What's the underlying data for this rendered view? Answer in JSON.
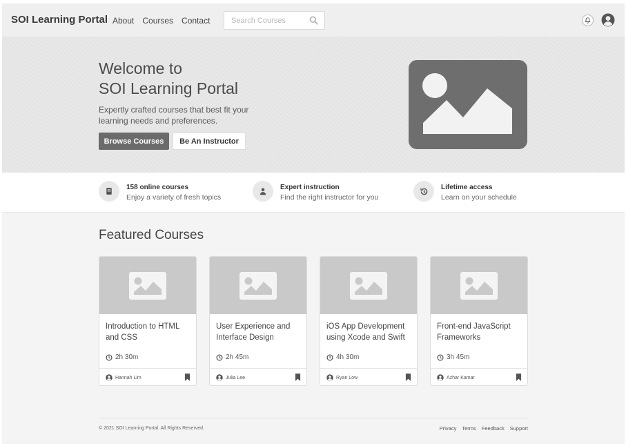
{
  "nav": {
    "brand": "SOI Learning Portal",
    "links": [
      "About",
      "Courses",
      "Contact"
    ],
    "search_placeholder": "Search Courses"
  },
  "hero": {
    "title_line1": "Welcome to",
    "title_line2": "SOI Learning Portal",
    "subtitle": "Expertly crafted courses that best fit your learning needs and preferences.",
    "primary_button": "Browse Courses",
    "secondary_button": "Be An Instructor"
  },
  "features": [
    {
      "title": "158 online courses",
      "desc": "Enjoy a variety of fresh topics",
      "icon": "book-icon"
    },
    {
      "title": "Expert instruction",
      "desc": "Find the right instructor for you",
      "icon": "instructor-icon"
    },
    {
      "title": "Lifetime access",
      "desc": "Learn on your schedule",
      "icon": "history-icon"
    }
  ],
  "featured": {
    "heading": "Featured Courses",
    "courses": [
      {
        "title": "Introduction to HTML and CSS",
        "duration": "2h 30m",
        "instructor": "Hannah Lim"
      },
      {
        "title": "User Experience and Interface Design",
        "duration": "2h 45m",
        "instructor": "Julia Lee"
      },
      {
        "title": "iOS App Development using Xcode and Swift",
        "duration": "4h 30m",
        "instructor": "Ryan Low"
      },
      {
        "title": "Front-end JavaScript Frameworks",
        "duration": "3h 45m",
        "instructor": "Azhar Kamar"
      }
    ]
  },
  "footer": {
    "copyright": "© 2021 SOI Learning Portal. All Rights Reserved.",
    "links": [
      "Privacy",
      "Terms",
      "Feedback",
      "Support"
    ]
  },
  "colors": {
    "primary_button": "#6b6b6b",
    "hero_image": "#6e6e6e",
    "thumb": "#c9c9c9"
  }
}
